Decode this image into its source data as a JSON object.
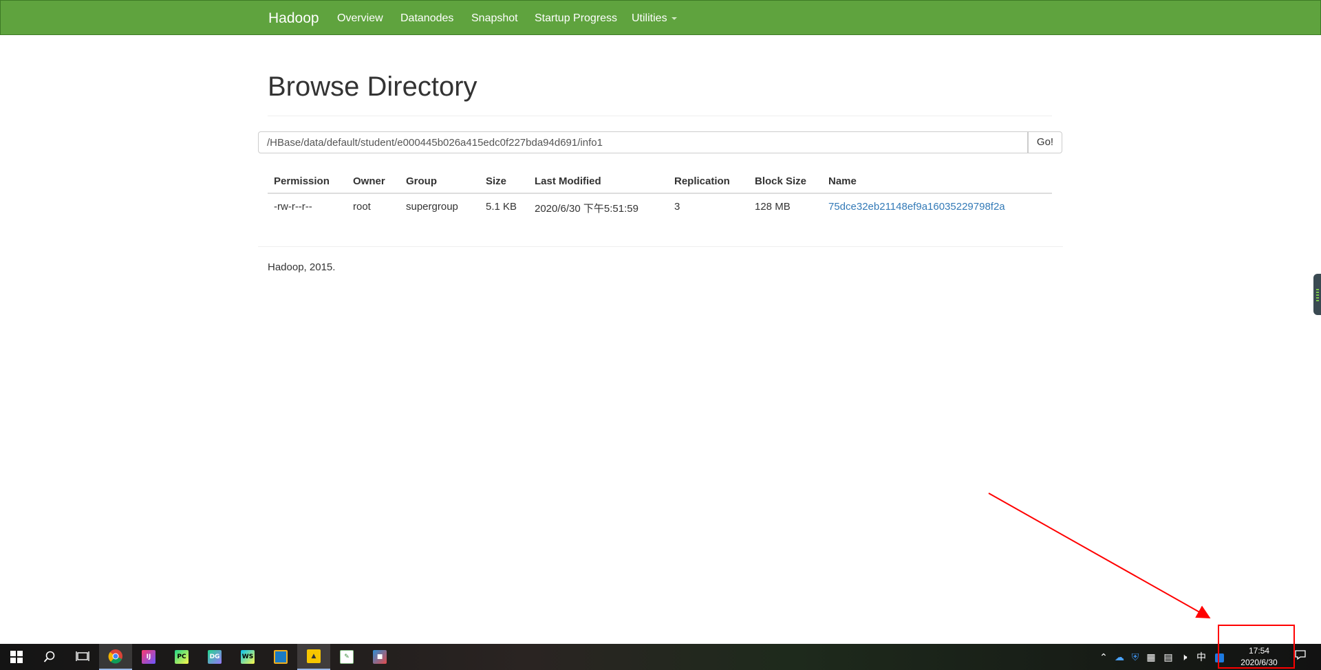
{
  "navbar": {
    "brand": "Hadoop",
    "items": [
      "Overview",
      "Datanodes",
      "Snapshot",
      "Startup Progress",
      "Utilities"
    ]
  },
  "page": {
    "title": "Browse Directory",
    "path_value": "/HBase/data/default/student/e000445b026a415edc0f227bda94d691/info1",
    "go_label": "Go!"
  },
  "table": {
    "headers": [
      "Permission",
      "Owner",
      "Group",
      "Size",
      "Last Modified",
      "Replication",
      "Block Size",
      "Name"
    ],
    "rows": [
      {
        "permission": "-rw-r--r--",
        "owner": "root",
        "group": "supergroup",
        "size": "5.1 KB",
        "last_modified": "2020/6/30 下午5:51:59",
        "replication": "3",
        "block_size": "128 MB",
        "name": "75dce32eb21148ef9a16035229798f2a"
      }
    ]
  },
  "footer": {
    "text": "Hadoop, 2015."
  },
  "taskbar": {
    "apps": [
      "windows-start-icon",
      "search-icon",
      "task-view-icon",
      "chrome-icon",
      "intellij-idea-icon",
      "pycharm-icon",
      "datagrip-icon",
      "webstorm-icon",
      "virtualbox-icon",
      "app-yellow-icon",
      "notepad-icon",
      "image-viewer-icon"
    ],
    "tray": {
      "ime": "中"
    },
    "clock": {
      "time": "17:54",
      "date": "2020/6/30"
    }
  },
  "colors": {
    "navbar": "#5fa33e",
    "link": "#337ab7",
    "annotation": "#ff0000"
  }
}
